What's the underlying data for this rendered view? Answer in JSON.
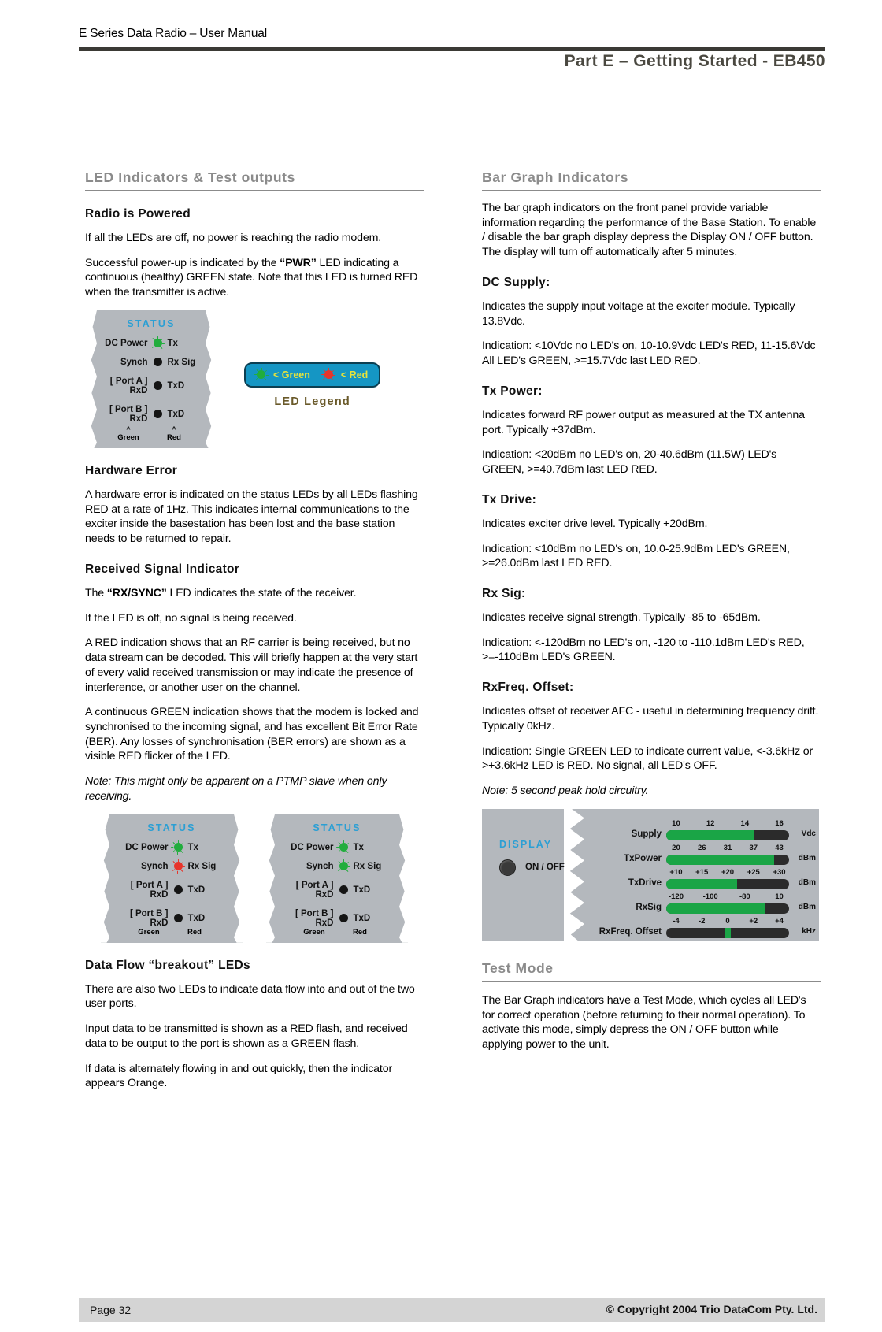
{
  "header": {
    "manual_title": "E Series Data Radio – User Manual",
    "part_title": "Part E –  Getting Started - EB450"
  },
  "left_column": {
    "section_heading": "LED Indicators & Test outputs",
    "radio_powered": {
      "heading": "Radio is Powered",
      "p1": "If all the LEDs are off, no power is reaching the radio modem.",
      "p2_pre": "Successful power-up is indicated by the ",
      "p2_bold": "“PWR”",
      "p2_post": " LED indicating a continuous (healthy) GREEN state. Note that this LED is turned RED when the transmitter is active."
    },
    "status_panel_1": {
      "title": "STATUS",
      "rows": [
        {
          "left": "DC Power",
          "led": "green",
          "right": "Tx"
        },
        {
          "left": "Synch",
          "led": "off",
          "right": "Rx Sig"
        },
        {
          "left": "[ Port A ] RxD",
          "led": "off",
          "right": "TxD"
        },
        {
          "left": "[ Port B ] RxD",
          "led": "off",
          "right": "TxD"
        }
      ],
      "caret_left": "^",
      "caret_right": "^",
      "foot_left": "Green",
      "foot_right": "Red"
    },
    "led_legend": {
      "green_label": "< Green",
      "red_label": "< Red",
      "caption": "LED Legend"
    },
    "hardware_error": {
      "heading": "Hardware Error",
      "p1": "A hardware error is indicated on the status LEDs by all LEDs flashing RED at a rate of 1Hz. This indicates internal communications to the exciter inside the basestation has been lost and the base station needs to be returned to repair."
    },
    "received_signal": {
      "heading": "Received Signal Indicator",
      "p1_pre": "The ",
      "p1_bold": "“RX/SYNC”",
      "p1_post": " LED  indicates the state of the receiver.",
      "p2": "If the LED is off, no signal is being received.",
      "p3": "A RED indication shows that an RF carrier is being received, but no data stream can be decoded. This will briefly happen at the very start of every valid received transmission or may indicate the presence of interference, or another user on the channel.",
      "p4": "A continuous GREEN indication shows that the modem is locked and synchronised to the incoming signal, and has excellent Bit Error Rate (BER). Any losses of synchronisation (BER errors) are shown as a visible RED flicker of the LED.",
      "note": "Note: This might only be apparent on a PTMP slave when only receiving."
    },
    "status_panel_2": {
      "title": "STATUS",
      "rows": [
        {
          "left": "DC Power",
          "led": "green",
          "right": "Tx"
        },
        {
          "left": "Synch",
          "led": "red",
          "right": "Rx Sig"
        },
        {
          "left": "[ Port A ] RxD",
          "led": "off",
          "right": "TxD"
        },
        {
          "left": "[ Port B ] RxD",
          "led": "off",
          "right": "TxD"
        }
      ],
      "foot_left": "Green",
      "foot_right": "Red"
    },
    "status_panel_3": {
      "title": "STATUS",
      "rows": [
        {
          "left": "DC Power",
          "led": "green",
          "right": "Tx"
        },
        {
          "left": "Synch",
          "led": "green",
          "right": "Rx Sig"
        },
        {
          "left": "[ Port A ] RxD",
          "led": "off",
          "right": "TxD"
        },
        {
          "left": "[ Port B ] RxD",
          "led": "off",
          "right": "TxD"
        }
      ],
      "foot_left": "Green",
      "foot_right": "Red"
    },
    "data_flow": {
      "heading": "Data Flow “breakout” LEDs",
      "p1": "There are also two LEDs to indicate data flow into and out of the two user ports.",
      "p2": "Input data to be transmitted is shown as a RED flash, and received data to be output to the port is shown as a GREEN flash.",
      "p3": "If data is alternately flowing in and out quickly, then the indicator appears Orange."
    }
  },
  "right_column": {
    "section_heading": "Bar Graph Indicators",
    "intro": "The bar graph indicators on the front panel provide variable information regarding the performance of the Base Station. To enable / disable the bar graph display depress the Display ON / OFF button. The display will turn off automatically after 5 minutes.",
    "dc_supply": {
      "heading": "DC Supply:",
      "p1": "Indicates the supply input voltage at the exciter module. Typically 13.8Vdc.",
      "p2": "Indication: <10Vdc no LED's on, 10-10.9Vdc LED's RED, 11-15.6Vdc All LED's GREEN, >=15.7Vdc last LED RED."
    },
    "tx_power": {
      "heading": "Tx Power:",
      "p1": "Indicates forward RF power output as measured at the TX antenna port. Typically +37dBm.",
      "p2": "Indication: <20dBm no LED's on, 20-40.6dBm (11.5W) LED's GREEN, >=40.7dBm last LED RED."
    },
    "tx_drive": {
      "heading": "Tx Drive:",
      "p1": "Indicates exciter drive level. Typically +20dBm.",
      "p2": "Indication: <10dBm no LED's on, 10.0-25.9dBm LED's GREEN, >=26.0dBm last LED RED."
    },
    "rx_sig": {
      "heading": "Rx Sig:",
      "p1": "Indicates receive signal strength. Typically -85 to -65dBm.",
      "p2": "Indication: <-120dBm no LED's on, -120 to -110.1dBm LED's RED, >=-110dBm LED's GREEN."
    },
    "rx_freq_offset": {
      "heading": "RxFreq. Offset:",
      "p1": "Indicates offset of receiver AFC - useful in determining frequency drift. Typically 0kHz.",
      "p2": "Indication: Single GREEN LED to indicate current value, <-3.6kHz or >+3.6kHz LED is RED. No signal, all LED's OFF.",
      "note": "Note: 5 second peak hold circuitry."
    },
    "test_mode": {
      "heading": "Test Mode",
      "p1": "The Bar Graph indicators have a Test Mode, which cycles all LED's for correct operation (before returning to their normal operation). To activate this mode, simply depress the ON / OFF button while applying power to the unit."
    }
  },
  "bar_graph_panel": {
    "display_label": "DISPLAY",
    "onoff_label": "ON / OFF",
    "bars": [
      {
        "label": "Supply",
        "ticks": [
          "10",
          "12",
          "14",
          "16"
        ],
        "unit": "Vdc",
        "fill_pct": 72,
        "mode": "fill"
      },
      {
        "label": "TxPower",
        "ticks": [
          "20",
          "26",
          "31",
          "37",
          "43"
        ],
        "unit": "dBm",
        "fill_pct": 88,
        "mode": "fill"
      },
      {
        "label": "TxDrive",
        "ticks": [
          "+10",
          "+15",
          "+20",
          "+25",
          "+30"
        ],
        "unit": "dBm",
        "fill_pct": 58,
        "mode": "fill"
      },
      {
        "label": "RxSig",
        "ticks": [
          "-120",
          "-100",
          "-80",
          "10"
        ],
        "unit": "dBm",
        "fill_pct": 80,
        "mode": "fill"
      },
      {
        "label": "RxFreq. Offset",
        "ticks": [
          "-4",
          "-2",
          "0",
          "+2",
          "+4"
        ],
        "unit": "kHz",
        "fill_pct": 50,
        "mode": "segment"
      }
    ]
  },
  "footer": {
    "page": "Page 32",
    "copyright": "© Copyright 2004 Trio DataCom Pty. Ltd."
  },
  "colors": {
    "heading_gray": "#8b8b8b",
    "panel_gray": "#b4b8bd",
    "led_green": "#21ad3d",
    "led_red": "#e8342a",
    "bar_green": "#1aa546",
    "cyan_label": "#2b9fd4"
  }
}
